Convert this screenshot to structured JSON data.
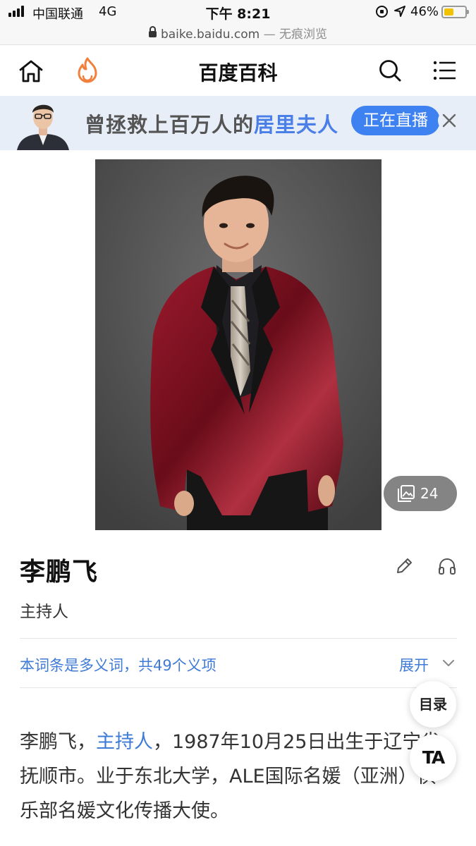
{
  "status_bar": {
    "carrier": "中国联通",
    "network": "4G",
    "time": "下午 8:21",
    "battery_percent": "46%",
    "battery_level": 0.46
  },
  "browser": {
    "url": "baike.baidu.com",
    "mode": "— 无痕浏览"
  },
  "nav": {
    "title": "百度百科",
    "icons": [
      "home-icon",
      "flame-icon",
      "search-icon",
      "menu-icon"
    ]
  },
  "banner": {
    "text_prefix": "曾拯救上百万人的",
    "text_highlight": "居里夫人",
    "live_label": "正在直播"
  },
  "gallery": {
    "count": "24"
  },
  "entry": {
    "name": "李鹏飞",
    "subtitle": "主持人",
    "polysemy_note": "本词条是多义词，共49个义项",
    "expand_label": "展开",
    "summary_part1": "李鹏飞，",
    "summary_link": "主持人",
    "summary_part2": "，1987年10月25日出生于辽宁省抚顺市。业于东北大学，ALE国际名媛（亚洲）俱乐部名媛文化传播大使。"
  },
  "floating": {
    "toc_label": "目录",
    "font_label": "TA"
  },
  "colors": {
    "accent_blue": "#3e81f0",
    "link_blue": "#3f7bd6",
    "banner_bg": "#e8eef8",
    "jacket_red": "#7a1020"
  }
}
